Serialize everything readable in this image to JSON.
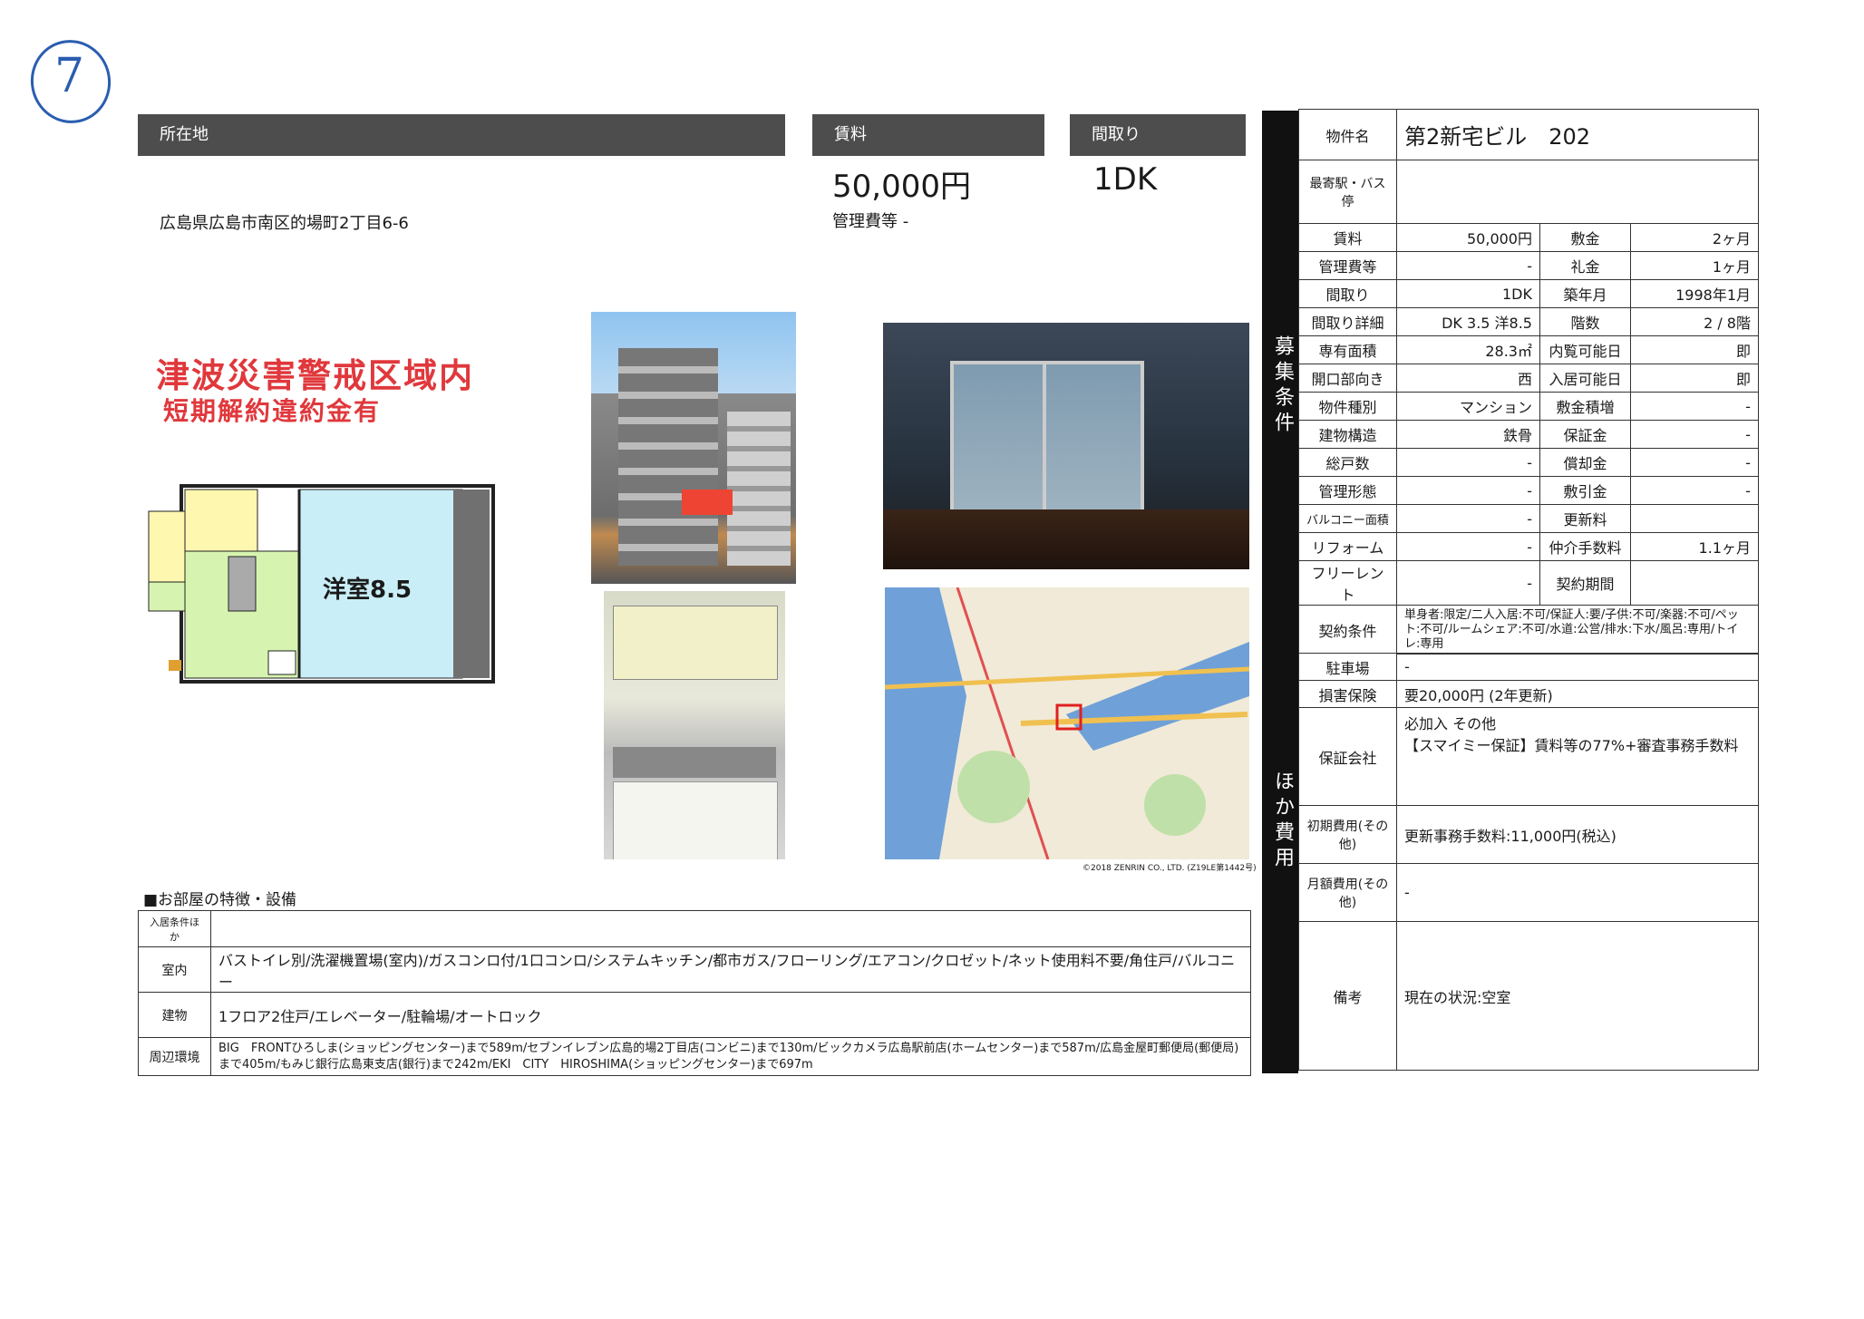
{
  "mark": "7",
  "address": {
    "header": "所在地",
    "value": "広島県広島市南区的場町2丁目6-6"
  },
  "rent": {
    "header": "賃料",
    "value": "50,000円",
    "note": "管理費等 -"
  },
  "layout": {
    "header": "間取り",
    "value": "1DK"
  },
  "warning": {
    "line1": "津波災害警戒区域内",
    "line2": "短期解約違約金有"
  },
  "floorplan": {
    "room_label": "洋室8.5"
  },
  "photo_caption": "©2018 ZENRIN CO., LTD. (Z19LE第1442号)",
  "side_labels": {
    "recruit": "募集条件",
    "other": "ほか費用"
  },
  "info": {
    "name_label": "物件名",
    "name_value": "第2新宅ビル　202",
    "station_label": "最寄駅・バス停",
    "station_value": "",
    "rows": [
      {
        "l1": "賃料",
        "v1": "50,000円",
        "l2": "敷金",
        "v2": "2ヶ月"
      },
      {
        "l1": "管理費等",
        "v1": "-",
        "l2": "礼金",
        "v2": "1ヶ月"
      },
      {
        "l1": "間取り",
        "v1": "1DK",
        "l2": "築年月",
        "v2": "1998年1月"
      },
      {
        "l1": "間取り詳細",
        "v1": "DK 3.5 洋8.5",
        "l2": "階数",
        "v2": "2 / 8階"
      },
      {
        "l1": "専有面積",
        "v1": "28.3㎡",
        "l2": "内覧可能日",
        "v2": "即"
      },
      {
        "l1": "開口部向き",
        "v1": "西",
        "l2": "入居可能日",
        "v2": "即"
      },
      {
        "l1": "物件種別",
        "v1": "マンション",
        "l2": "敷金積増",
        "v2": "-"
      },
      {
        "l1": "建物構造",
        "v1": "鉄骨",
        "l2": "保証金",
        "v2": "-"
      },
      {
        "l1": "総戸数",
        "v1": "-",
        "l2": "償却金",
        "v2": "-"
      },
      {
        "l1": "管理形態",
        "v1": "-",
        "l2": "敷引金",
        "v2": "-"
      },
      {
        "l1": "バルコニー面積",
        "v1": "-",
        "l2": "更新料",
        "v2": ""
      },
      {
        "l1": "リフォーム",
        "v1": "-",
        "l2": "仲介手数料",
        "v2": "1.1ヶ月"
      },
      {
        "l1": "フリーレント",
        "v1": "-",
        "l2": "契約期間",
        "v2": ""
      }
    ],
    "contract_label": "契約条件",
    "contract_value": "単身者:限定/二人入居:不可/保証人:要/子供:不可/楽器:不可/ペット:不可/ルームシェア:不可/水道:公営/排水:下水/風呂:専用/トイレ:専用"
  },
  "costs": {
    "parking_label": "駐車場",
    "parking_value": "-",
    "insurance_label": "損害保険",
    "insurance_value": "要20,000円 (2年更新)",
    "guarantor_label": "保証会社",
    "guarantor_line1": "必加入 その他",
    "guarantor_line2": "【スマイミー保証】賃料等の77%+審査事務手数料",
    "initial_label": "初期費用(その他)",
    "initial_value": "更新事務手数料:11,000円(税込)",
    "monthly_label": "月額費用(その他)",
    "monthly_value": "-",
    "remarks_label": "備考",
    "remarks_value": "現在の状況:空室"
  },
  "features": {
    "title": "■お部屋の特徴・設備",
    "rows": [
      {
        "k": "入居条件ほか",
        "v": ""
      },
      {
        "k": "室内",
        "v": "バストイレ別/洗濯機置場(室内)/ガスコンロ付/1口コンロ/システムキッチン/都市ガス/フローリング/エアコン/クロゼット/ネット使用料不要/角住戸/バルコニー"
      },
      {
        "k": "建物",
        "v": "1フロア2住戸/エレベーター/駐輪場/オートロック"
      },
      {
        "k": "周辺環境",
        "v": "BIG　FRONTひろしま(ショッピングセンター)まで589m/セブンイレブン広島的場2丁目店(コンビニ)まで130m/ビックカメラ広島駅前店(ホームセンター)まで587m/広島金屋町郵便局(郵便局)まで405m/もみじ銀行広島東支店(銀行)まで242m/EKI　CITY　HIROSHIMA(ショッピングセンター)まで697m"
      }
    ]
  }
}
